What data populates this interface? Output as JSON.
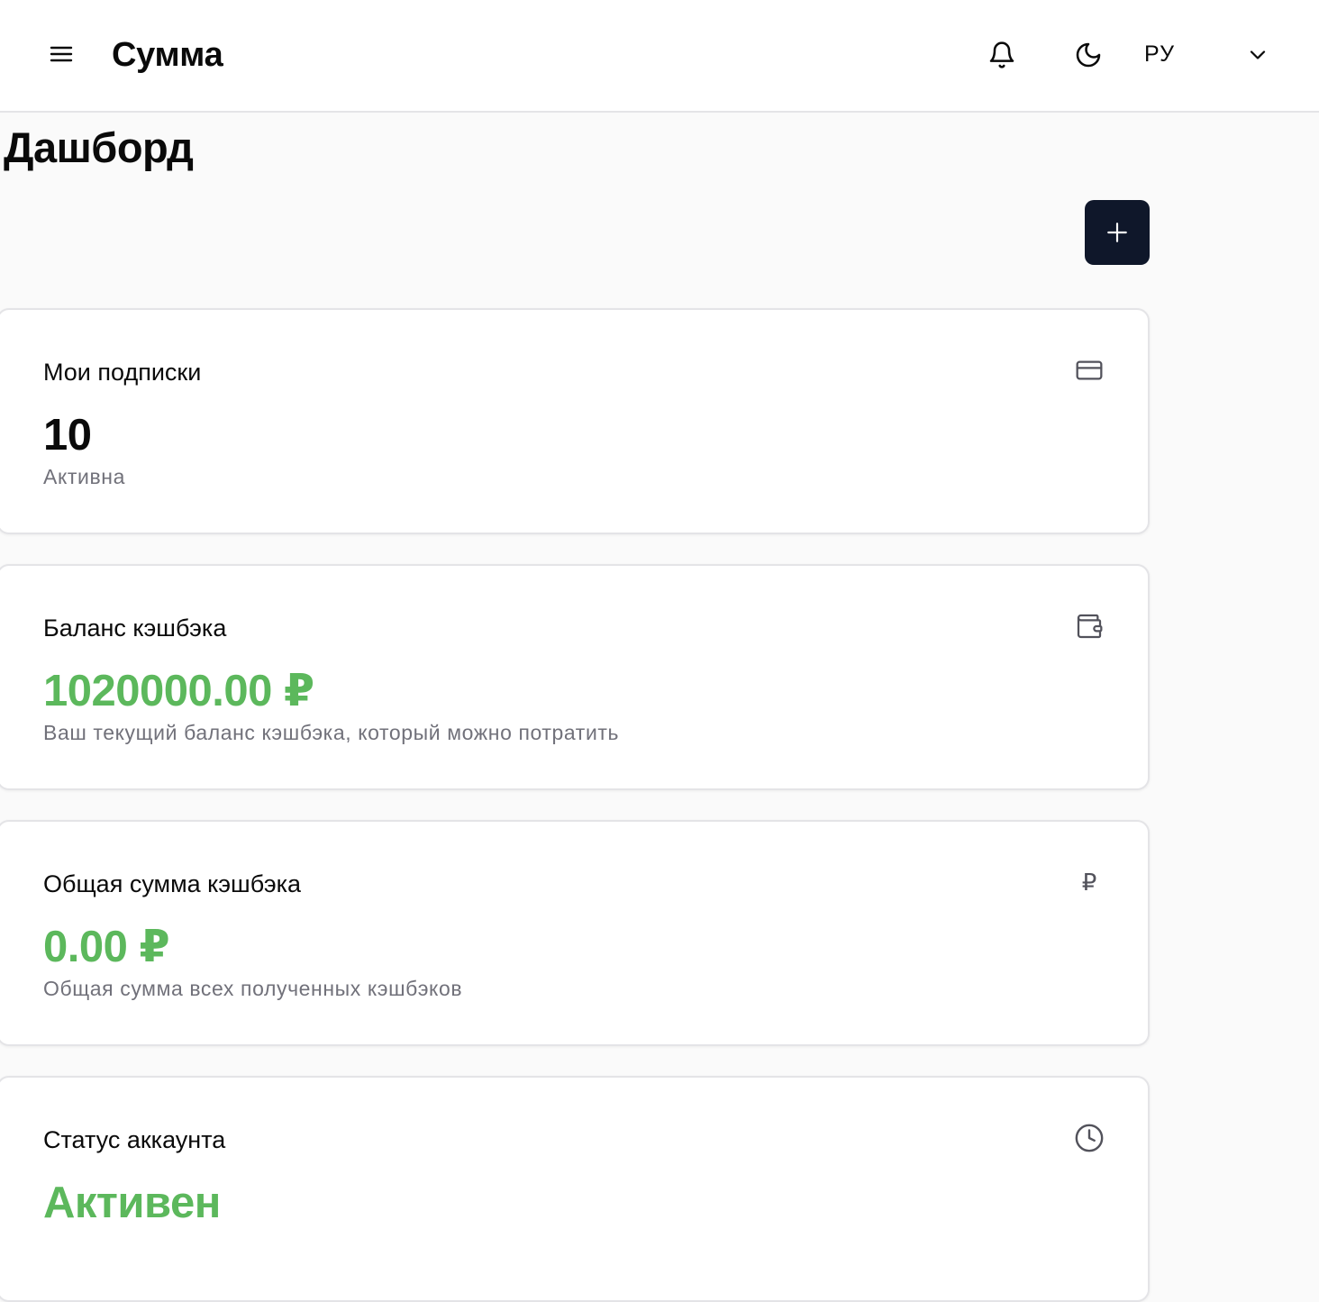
{
  "header": {
    "app_title": "Сумма",
    "language": "РУ"
  },
  "page": {
    "title": "Дашборд"
  },
  "icons": {
    "menu": "menu-icon",
    "notifications": "bell-icon",
    "theme": "moon-icon",
    "language_dropdown": "chevron-down-icon",
    "add": "plus-icon"
  },
  "cards": [
    {
      "title": "Мои подписки",
      "value": "10",
      "description": "Активна",
      "icon": "credit-card-icon"
    },
    {
      "title": "Баланс кэшбэка",
      "value": "1020000.00 ₽",
      "description": "Ваш текущий баланс кэшбэка, который можно потратить",
      "icon": "wallet-icon"
    },
    {
      "title": "Общая сумма кэшбэка",
      "value": "0.00 ₽",
      "description": "Общая сумма всех полученных кэшбэков",
      "icon": "ruble-icon",
      "icon_glyph": "₽"
    },
    {
      "title": "Статус аккаунта",
      "value": "Активен",
      "description": "",
      "icon": "clock-icon"
    }
  ],
  "colors": {
    "accent_green": "#5cb85c",
    "primary_button": "#0f172a",
    "muted_text": "#71717a"
  }
}
